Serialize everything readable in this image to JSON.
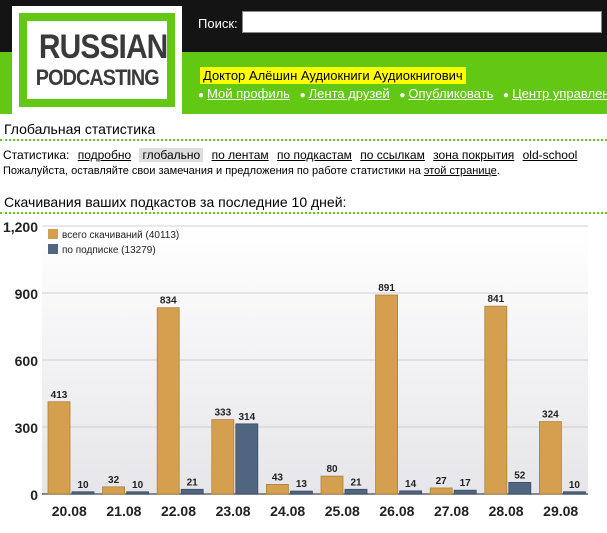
{
  "logo": {
    "line1": "RUSSIAN",
    "line2": "PODCASTING"
  },
  "search": {
    "label": "Поиск:",
    "value": ""
  },
  "user": {
    "name": "Доктор Алёшин Аудиокниги Аудиокнигович"
  },
  "usernav": [
    "Мой профиль",
    "Лента друзей",
    "Опубликовать",
    "Центр управления"
  ],
  "global_title": "Глобальная статистика",
  "stats_nav": {
    "label": "Статистика:",
    "items": [
      "подробно",
      "глобально",
      "по лентам",
      "по подкастам",
      "по ссылкам",
      "зона покрытия",
      "old-school"
    ],
    "active": "глобально"
  },
  "note": {
    "text": "Пожалуйста, оставляйте свои замечания и предложения по работе статистики на ",
    "link": "этой странице",
    "end": "."
  },
  "chart_title": "Скачивания ваших подкастов за последние 10 дней:",
  "colors": {
    "total": "#d4a050",
    "subscribed": "#506680",
    "brand_green": "#62c814"
  },
  "chart_data": {
    "type": "bar",
    "categories": [
      "20.08",
      "21.08",
      "22.08",
      "23.08",
      "24.08",
      "25.08",
      "26.08",
      "27.08",
      "28.08",
      "29.08"
    ],
    "series": [
      {
        "name": "всего скачиваний (40113)",
        "values": [
          413,
          32,
          834,
          333,
          43,
          80,
          891,
          27,
          841,
          324
        ]
      },
      {
        "name": "по подписке (13279)",
        "values": [
          10,
          10,
          21,
          314,
          13,
          21,
          14,
          17,
          52,
          10
        ]
      }
    ],
    "y_ticks": [
      "0",
      "300",
      "600",
      "900",
      "1,200"
    ],
    "ylim": [
      0,
      1200
    ],
    "legend": "top-left",
    "grid": true
  }
}
